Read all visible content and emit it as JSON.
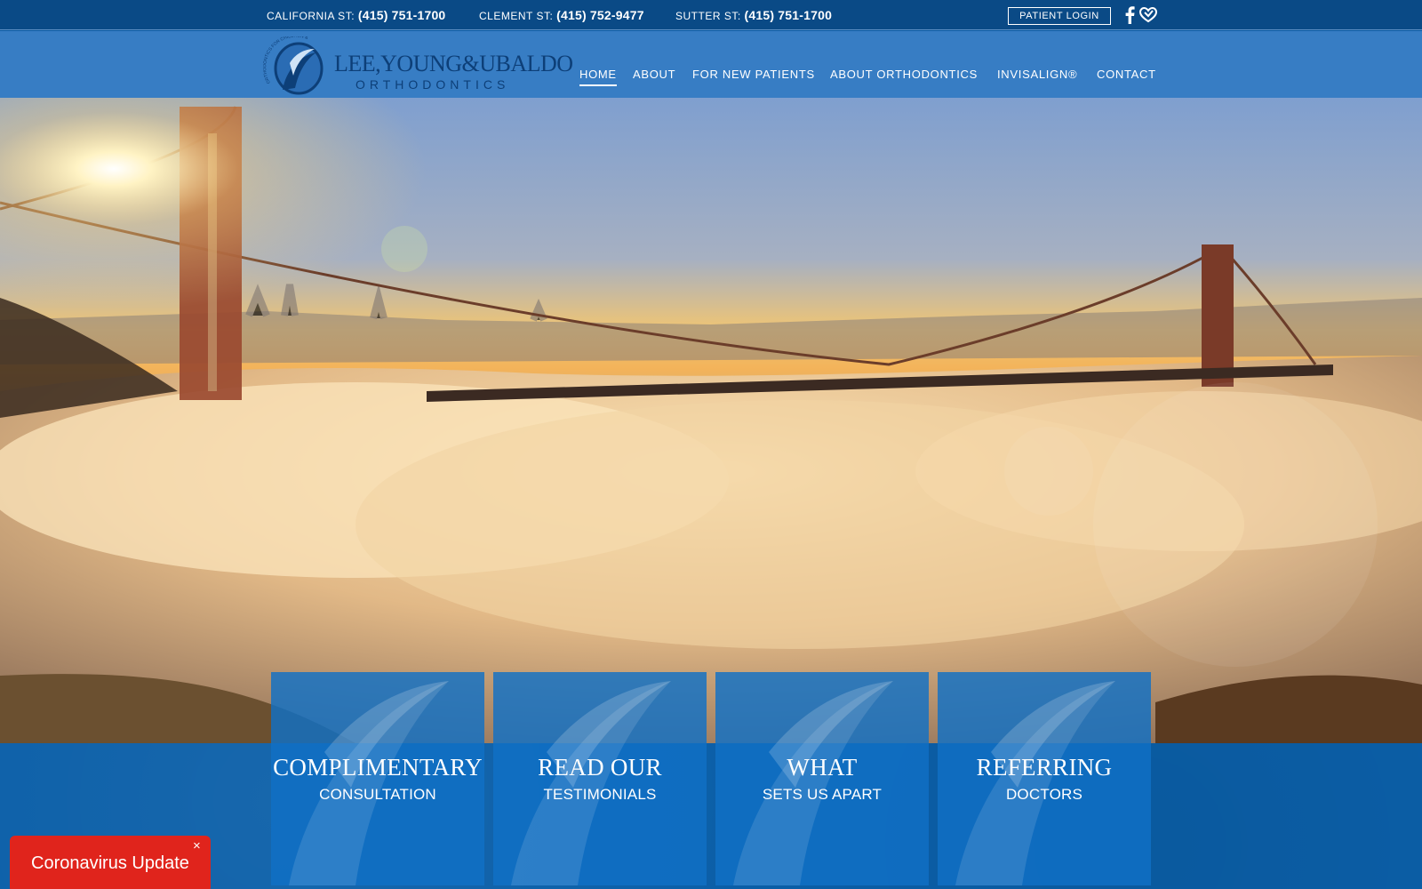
{
  "topbar": {
    "phones": [
      {
        "label": "CALIFORNIA ST:",
        "number": "(415) 751-1700"
      },
      {
        "label": "CLEMENT ST:",
        "number": "(415) 752-9477"
      },
      {
        "label": "SUTTER ST:",
        "number": "(415) 751-1700"
      }
    ],
    "patient_login": "PATIENT LOGIN",
    "icons": [
      "facebook-icon",
      "heart-hands-icon"
    ]
  },
  "logo": {
    "name": "LEE,YOUNG&UBALDO",
    "subtitle": "ORTHODONTICS",
    "ring_text": "ORTHODONTICS FOR CHILDREN & ADULTS"
  },
  "nav": {
    "items": [
      {
        "label": "HOME",
        "active": true
      },
      {
        "label": "ABOUT",
        "active": false
      },
      {
        "label": "FOR NEW PATIENTS",
        "active": false
      },
      {
        "label": "ABOUT ORTHODONTICS",
        "active": false
      },
      {
        "label": "INVISALIGN®",
        "active": false
      },
      {
        "label": "CONTACT",
        "active": false
      }
    ]
  },
  "tiles": [
    {
      "title": "COMPLIMENTARY",
      "subtitle": "CONSULTATION"
    },
    {
      "title": "READ OUR",
      "subtitle": "TESTIMONIALS"
    },
    {
      "title": "WHAT",
      "subtitle": "SETS US APART"
    },
    {
      "title": "REFERRING",
      "subtitle": "DOCTORS"
    }
  ],
  "alert": {
    "label": "Coronavirus Update",
    "close": "×"
  },
  "colors": {
    "topbar": "#0a4a86",
    "header": "#3a80c6",
    "tile": "#1070c6",
    "band": "#0b5fa8",
    "alert": "#e0241c"
  }
}
